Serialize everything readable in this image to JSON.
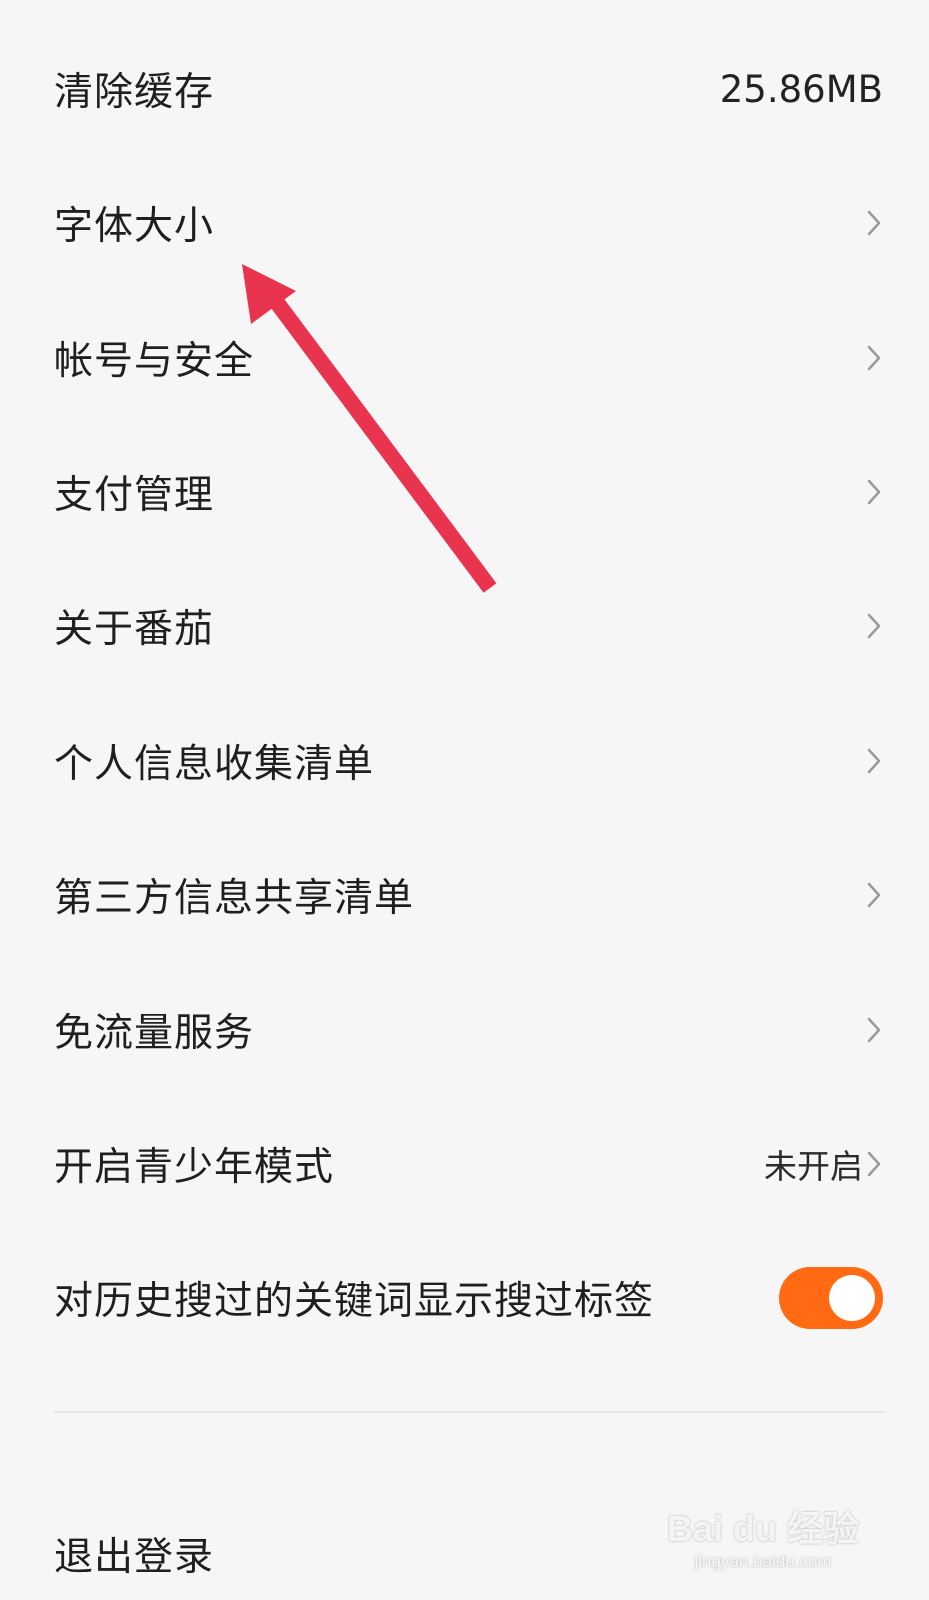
{
  "settings": {
    "clear_cache": {
      "label": "清除缓存",
      "value": "25.86MB"
    },
    "font_size": {
      "label": "字体大小"
    },
    "account_security": {
      "label": "帐号与安全"
    },
    "payment": {
      "label": "支付管理"
    },
    "about": {
      "label": "关于番茄"
    },
    "personal_info": {
      "label": "个人信息收集清单"
    },
    "third_party": {
      "label": "第三方信息共享清单"
    },
    "data_free": {
      "label": "免流量服务"
    },
    "teen_mode": {
      "label": "开启青少年模式",
      "value": "未开启"
    },
    "search_tag": {
      "label": "对历史搜过的关键词显示搜过标签",
      "toggle_on": true
    },
    "logout": {
      "label": "退出登录"
    }
  },
  "watermark": {
    "brand": "Bai du 经验",
    "url": "jingyan.baidu.com"
  },
  "colors": {
    "accent": "#ff6a13",
    "arrow": "#e8344e",
    "background": "#f6f6f6"
  },
  "icons": {
    "chevron": "chevron-right-icon",
    "annotation": "red-arrow-icon"
  }
}
